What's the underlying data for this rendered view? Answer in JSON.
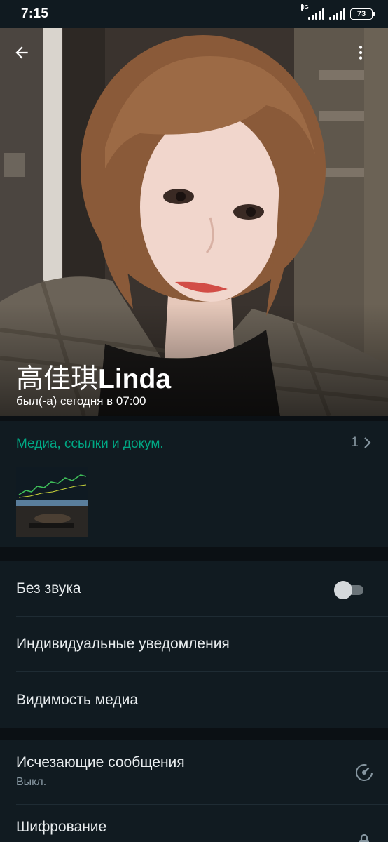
{
  "status_bar": {
    "time": "7:15",
    "network_label": "4G",
    "battery_level": "73"
  },
  "header": {
    "back_icon": "arrow-left-icon",
    "menu_icon": "more-vertical-icon"
  },
  "profile": {
    "name_cjk": "高佳琪",
    "name_latin": "Linda",
    "last_seen": "был(-а) сегодня в 07:00"
  },
  "media": {
    "title": "Медиа, ссылки и докум.",
    "count": "1",
    "chevron_icon": "chevron-right-icon"
  },
  "settings": {
    "mute_label": "Без звука",
    "mute_enabled": false,
    "custom_notifications_label": "Индивидуальные уведомления",
    "media_visibility_label": "Видимость медиа"
  },
  "privacy": {
    "disappearing_label": "Исчезающие сообщения",
    "disappearing_value": "Выкл.",
    "disappearing_icon": "timer-icon",
    "encryption_label": "Шифрование",
    "encryption_icon": "lock-icon"
  },
  "colors": {
    "accent": "#00a884",
    "background": "#0b1014",
    "surface": "#111b21",
    "secondary_text": "#8696a0"
  }
}
